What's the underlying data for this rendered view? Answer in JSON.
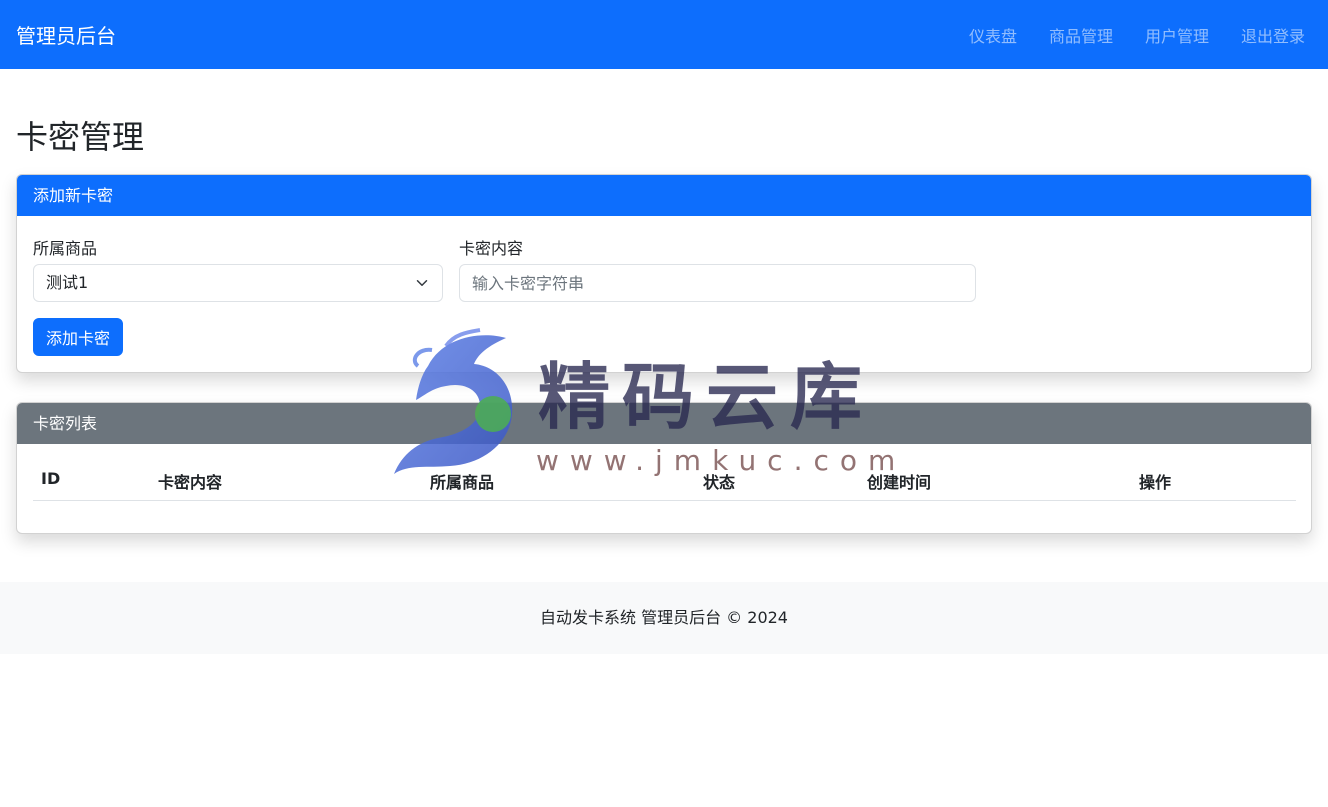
{
  "header": {
    "brand": "管理员后台",
    "nav": [
      "仪表盘",
      "商品管理",
      "用户管理",
      "退出登录"
    ]
  },
  "page": {
    "title": "卡密管理"
  },
  "add_card": {
    "header": "添加新卡密",
    "product_label": "所属商品",
    "product_selected": "测试1",
    "content_label": "卡密内容",
    "content_placeholder": "输入卡密字符串",
    "submit_label": "添加卡密"
  },
  "list_card": {
    "header": "卡密列表",
    "columns": [
      "ID",
      "卡密内容",
      "所属商品",
      "状态",
      "创建时间",
      "操作"
    ],
    "rows": []
  },
  "footer": {
    "text": "自动发卡系统 管理员后台 © 2024"
  },
  "watermark": {
    "name": "精码云库",
    "url": "www.jmkuc.com"
  },
  "colors": {
    "primary": "#0d6efd",
    "secondary": "#6c757d",
    "footer_bg": "#f8f9fa"
  }
}
